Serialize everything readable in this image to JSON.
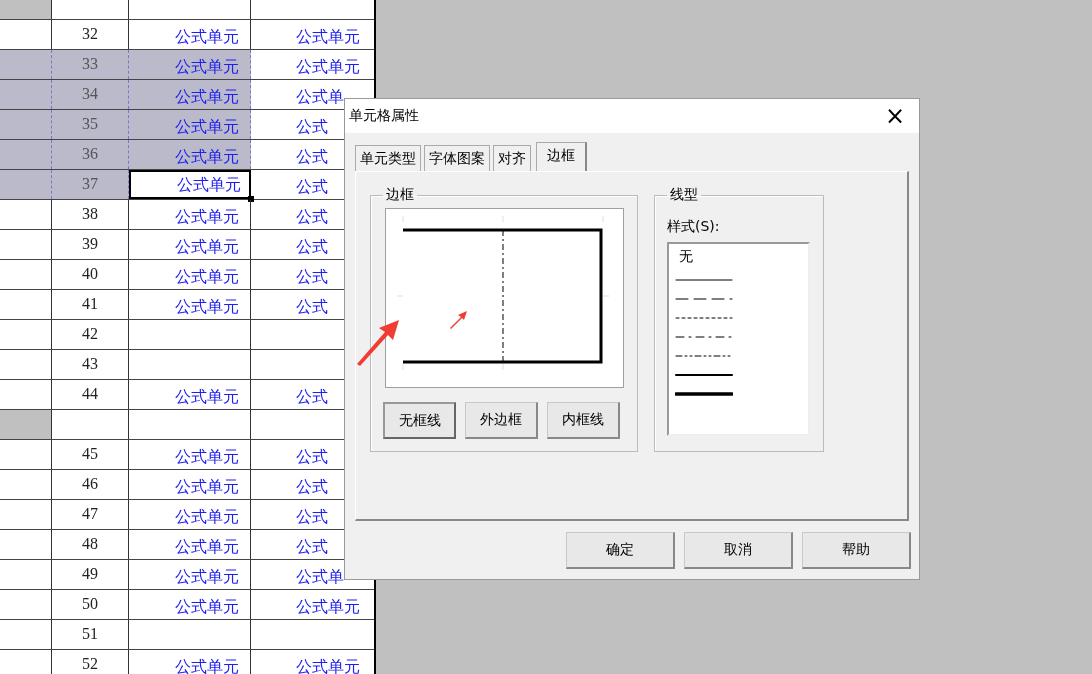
{
  "sheet": {
    "rows": [
      {
        "kind": "band"
      },
      {
        "kind": "data",
        "number": "32",
        "selected": false,
        "active": false,
        "column_3": "公式单元",
        "column_4": "公式单元"
      },
      {
        "kind": "data",
        "number": "33",
        "selected": true,
        "active": false,
        "column_3": "公式单元",
        "column_4": "公式单元"
      },
      {
        "kind": "data",
        "number": "34",
        "selected": true,
        "active": false,
        "column_3": "公式单元",
        "column_4": "公式单"
      },
      {
        "kind": "data",
        "number": "35",
        "selected": true,
        "active": false,
        "column_3": "公式单元",
        "column_4": "公式"
      },
      {
        "kind": "data",
        "number": "36",
        "selected": true,
        "active": false,
        "column_3": "公式单元",
        "column_4": "公式"
      },
      {
        "kind": "data",
        "number": "37",
        "selected": true,
        "active": true,
        "column_3": "公式单元",
        "column_4": "公式"
      },
      {
        "kind": "data",
        "number": "38",
        "selected": false,
        "active": false,
        "column_3": "公式单元",
        "column_4": "公式"
      },
      {
        "kind": "data",
        "number": "39",
        "selected": false,
        "active": false,
        "column_3": "公式单元",
        "column_4": "公式"
      },
      {
        "kind": "data",
        "number": "40",
        "selected": false,
        "active": false,
        "column_3": "公式单元",
        "column_4": "公式"
      },
      {
        "kind": "data",
        "number": "41",
        "selected": false,
        "active": false,
        "column_3": "公式单元",
        "column_4": "公式"
      },
      {
        "kind": "data",
        "number": "42",
        "selected": false,
        "active": false
      },
      {
        "kind": "data",
        "number": "43",
        "selected": false,
        "active": false
      },
      {
        "kind": "data",
        "number": "44",
        "selected": false,
        "active": false,
        "column_3": "公式单元",
        "column_4": "公式"
      },
      {
        "kind": "band"
      },
      {
        "kind": "data",
        "number": "45",
        "selected": false,
        "active": false,
        "column_3": "公式单元",
        "column_4": "公式"
      },
      {
        "kind": "data",
        "number": "46",
        "selected": false,
        "active": false,
        "column_3": "公式单元",
        "column_4": "公式"
      },
      {
        "kind": "data",
        "number": "47",
        "selected": false,
        "active": false,
        "column_3": "公式单元",
        "column_4": "公式"
      },
      {
        "kind": "data",
        "number": "48",
        "selected": false,
        "active": false,
        "column_3": "公式单元",
        "column_4": "公式"
      },
      {
        "kind": "data",
        "number": "49",
        "selected": false,
        "active": false,
        "column_3": "公式单元",
        "column_4": "公式单"
      },
      {
        "kind": "data",
        "number": "50",
        "selected": false,
        "active": false,
        "column_3": "公式单元",
        "column_4": "公式单元"
      },
      {
        "kind": "data",
        "number": "51",
        "selected": false,
        "active": false
      },
      {
        "kind": "data",
        "number": "52",
        "selected": false,
        "active": false,
        "column_3": "公式单元",
        "column_4": "公式单元"
      }
    ]
  },
  "dialog": {
    "title": "单元格属性",
    "close": "×",
    "tabs": [
      {
        "label": "单元类型",
        "selected": false
      },
      {
        "label": "字体图案",
        "selected": false
      },
      {
        "label": "对齐",
        "selected": false
      },
      {
        "label": "边框",
        "selected": true
      }
    ],
    "border_group": {
      "title": "边框",
      "buttons": [
        {
          "label": "无框线",
          "focused": true
        },
        {
          "label": "外边框",
          "focused": false
        },
        {
          "label": "内框线",
          "focused": false
        }
      ]
    },
    "line_group": {
      "title": "线型",
      "label": "样式(S):",
      "styles": [
        {
          "kind": "text",
          "label": "无"
        },
        {
          "kind": "solid"
        },
        {
          "kind": "long-dash"
        },
        {
          "kind": "dotted"
        },
        {
          "kind": "dash-dot"
        },
        {
          "kind": "dash-dot-dot"
        },
        {
          "kind": "medium"
        },
        {
          "kind": "thick"
        }
      ]
    },
    "buttons": [
      "确定",
      "取消",
      "帮助"
    ]
  }
}
